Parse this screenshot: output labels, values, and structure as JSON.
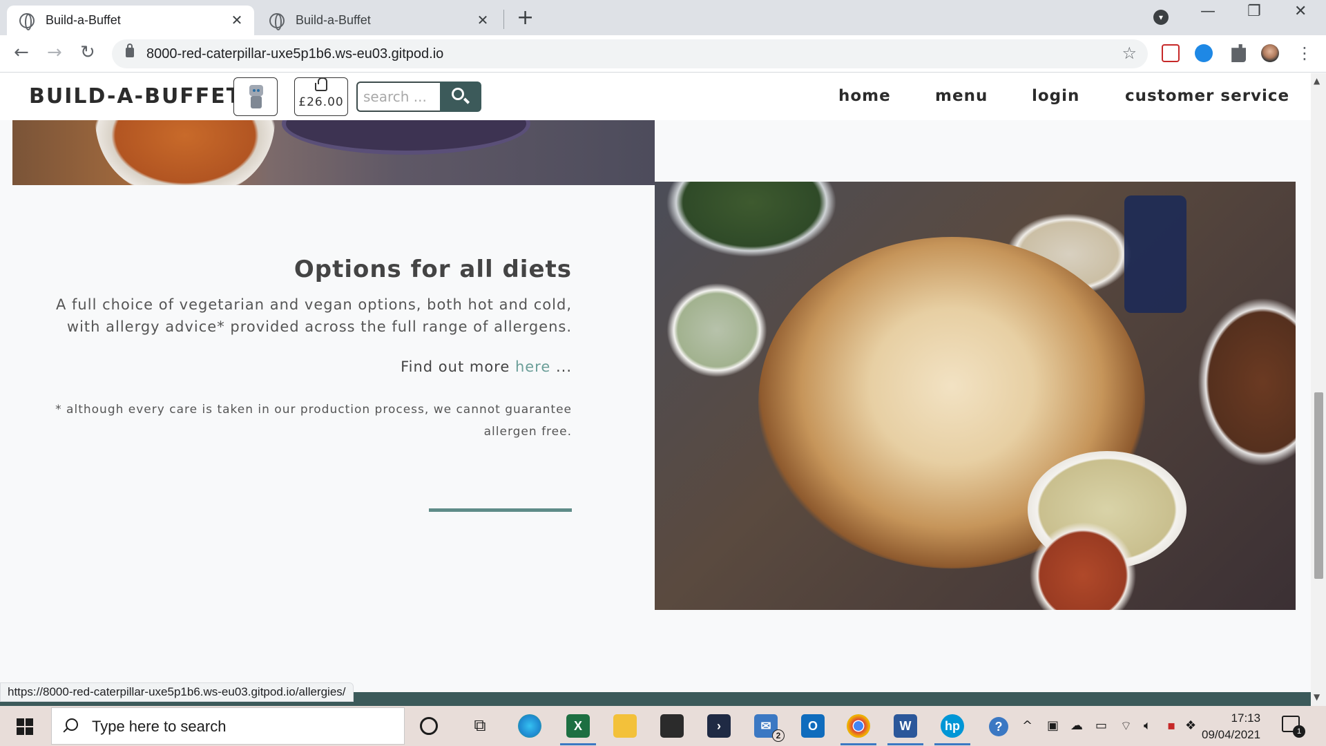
{
  "browser": {
    "tabs": [
      {
        "title": "Build-a-Buffet"
      },
      {
        "title": "Build-a-Buffet"
      }
    ],
    "url": "8000-red-caterpillar-uxe5p1b6.ws-eu03.gitpod.io",
    "status_url": "https://8000-red-caterpillar-uxe5p1b6.ws-eu03.gitpod.io/allergies/"
  },
  "site": {
    "brand": "BUILD-A-BUFFET",
    "basket_total": "£26.00",
    "search_placeholder": "search ...",
    "nav": [
      "home",
      "menu",
      "login",
      "customer service"
    ],
    "accent_color": "#5f8c88",
    "nav_button_color": "#3c5a5a"
  },
  "section": {
    "heading": "Options for all diets",
    "paragraph": "A full choice of vegetarian and vegan options, both hot and cold, with allergy advice* provided across the full range of allergens.",
    "find_more_prefix": "Find out more",
    "find_more_link": "here",
    "find_more_suffix": "...",
    "footnote": "* although every care is taken in our production process, we cannot guarantee allergen free."
  },
  "taskbar": {
    "search_text": "Type here to search",
    "time": "17:13",
    "date": "09/04/2021",
    "mail_badge": "2",
    "notification_count": "1"
  }
}
